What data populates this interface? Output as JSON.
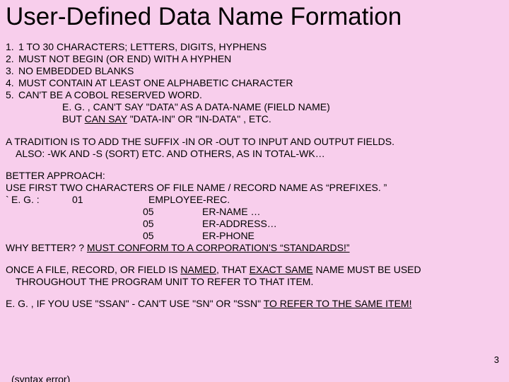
{
  "title": "User-Defined Data Name Formation",
  "rules": [
    {
      "n": "1.",
      "t": "1 TO 30 CHARACTERS;  LETTERS, DIGITS, HYPHENS"
    },
    {
      "n": "2.",
      "t": "MUST NOT BEGIN (OR END) WITH A HYPHEN"
    },
    {
      "n": "3.",
      "t": "NO EMBEDDED BLANKS"
    },
    {
      "n": "4.",
      "t": "MUST CONTAIN AT LEAST ONE ALPHABETIC CHARACTER"
    },
    {
      "n": "5.",
      "t": "CAN'T BE A COBOL RESERVED WORD."
    }
  ],
  "rule5_sub1": "E. G. , CAN'T SAY \"DATA\" AS A DATA-NAME (FIELD NAME)",
  "rule5_sub2_a": "BUT ",
  "rule5_sub2_b": "CAN SAY",
  "rule5_sub2_c": " \"DATA-IN\" OR \"IN-DATA\" , ETC.",
  "para1_l1": "A TRADITION  IS TO ADD THE SUFFIX -IN OR -OUT TO INPUT AND OUTPUT FIELDS.",
  "para1_l2": "ALSO:  -WK AND -S (SORT) ETC. AND OTHERS, AS IN TOTAL-WK…",
  "better_hdr": "BETTER APPROACH:",
  "better_l1": "USE FIRST TWO CHARACTERS OF FILE NAME / RECORD NAME AS “PREFIXES. ”",
  "eg_label": "E. G. :",
  "eg_lvl01": "01",
  "eg_lvl05": "05",
  "eg_emp": "EMPLOYEE-REC.",
  "eg_name": "ER-NAME …",
  "eg_addr": "ER-ADDRESS…",
  "eg_phone": "ER-PHONE",
  "why_a": "WHY BETTER? ? ",
  "why_b": " MUST CONFORM TO A CORPORATION'S “STANDARDS!”",
  "once_a": "ONCE A FILE, RECORD, OR FIELD IS ",
  "once_b": "NAMED",
  "once_c": ", THAT ",
  "once_d": "EXACT SAME",
  "once_e": " NAME MUST BE USED",
  "once_f": "THROUGHOUT THE PROGRAM UNIT TO REFER TO THAT ITEM.",
  "last_a": "E. G. ,  IF YOU USE \"SSAN\" - CAN'T USE \"SN\" OR \"SSN\" ",
  "last_b": "TO REFER TO THE SAME ITEM!",
  "cutoff": "(syntax error)",
  "slide_num": "3"
}
